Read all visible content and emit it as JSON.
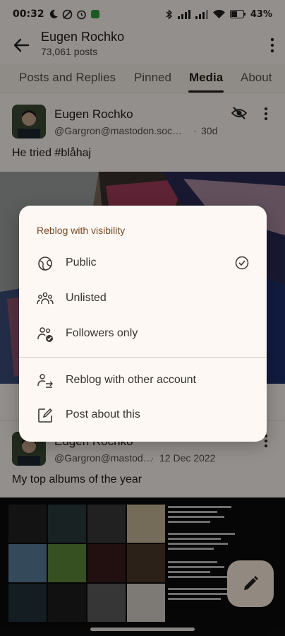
{
  "status_bar": {
    "time": "00:32",
    "battery": "43"
  },
  "app_bar": {
    "title": "Eugen Rochko",
    "subtitle": "73,061 posts"
  },
  "tabs": [
    {
      "label": "Posts and Replies",
      "active": false
    },
    {
      "label": "Pinned",
      "active": false
    },
    {
      "label": "Media",
      "active": true
    },
    {
      "label": "About",
      "active": false
    }
  ],
  "posts": [
    {
      "author": "Eugen Rochko",
      "handle": "@Gargron@mastodon.soc…",
      "time": "30d",
      "text": "He tried #blåhaj"
    },
    {
      "author": "Eugen Rochko",
      "handle": "@Gargron@mastod…",
      "time": "12 Dec 2022",
      "text": "My top albums of the year"
    }
  ],
  "dialog": {
    "title": "Reblog with visibility",
    "visibility_options": [
      {
        "label": "Public",
        "icon": "globe-icon",
        "selected": true
      },
      {
        "label": "Unlisted",
        "icon": "people-group-icon",
        "selected": false
      },
      {
        "label": "Followers only",
        "icon": "people-check-icon",
        "selected": false
      }
    ],
    "actions": [
      {
        "label": "Reblog with other account",
        "icon": "switch-account-icon"
      },
      {
        "label": "Post about this",
        "icon": "edit-square-icon"
      }
    ]
  },
  "colors": {
    "background": "#fbf6f1",
    "dialog_title": "#7a4a24",
    "scrim": "rgba(0,0,0,0.42)"
  }
}
